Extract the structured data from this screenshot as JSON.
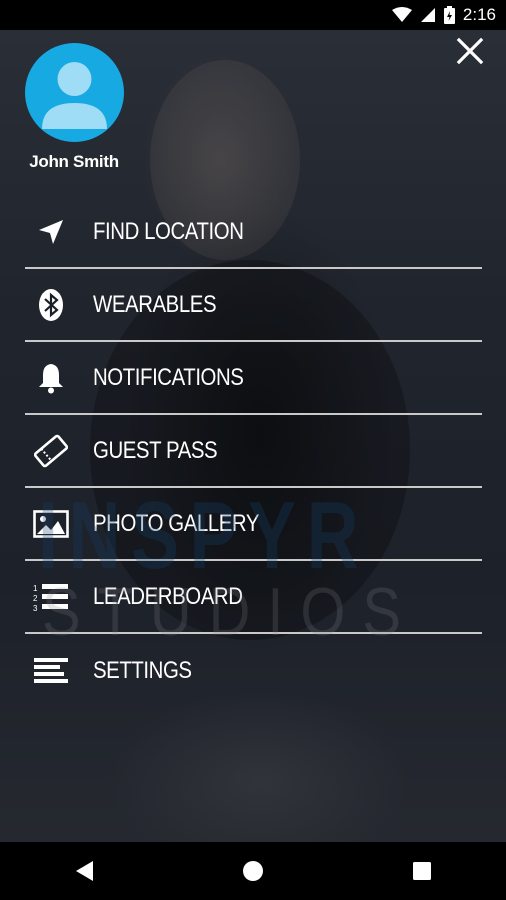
{
  "status_bar": {
    "time": "2:16",
    "icons": [
      "wifi-icon",
      "cell-signal-icon",
      "battery-icon"
    ]
  },
  "drawer": {
    "close_icon": "close-icon",
    "user": {
      "name": "John Smith",
      "avatar_icon": "person-avatar-icon",
      "avatar_color": "#17a9e1"
    },
    "items": [
      {
        "label": "FIND LOCATION",
        "icon": "location-arrow-icon"
      },
      {
        "label": "WEARABLES",
        "icon": "bluetooth-icon"
      },
      {
        "label": "NOTIFICATIONS",
        "icon": "bell-icon"
      },
      {
        "label": "GUEST PASS",
        "icon": "ticket-icon"
      },
      {
        "label": "PHOTO GALLERY",
        "icon": "image-icon"
      },
      {
        "label": "LEADERBOARD",
        "icon": "ordered-list-icon"
      },
      {
        "label": "SETTINGS",
        "icon": "settings-lines-icon"
      }
    ]
  },
  "watermark": {
    "line1": "INSPYR",
    "line2": "STUDIOS"
  },
  "nav_bar": {
    "buttons": [
      "back-icon",
      "home-icon",
      "recents-icon"
    ]
  }
}
